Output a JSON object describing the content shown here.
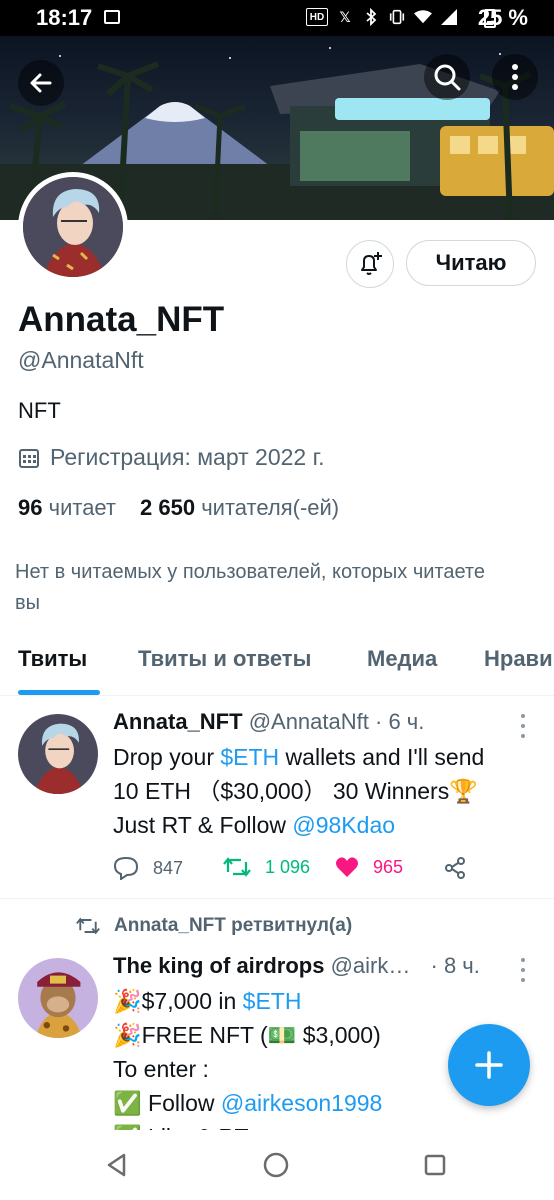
{
  "status_bar": {
    "time": "18:17",
    "battery": "25 %",
    "icons": [
      "picture-icon",
      "hd-signal-icon",
      "x-icon",
      "bluetooth-icon",
      "vibrate-icon",
      "wifi-icon",
      "signal-icon",
      "battery-icon"
    ]
  },
  "header": {
    "back_icon": "arrow-left-icon",
    "search_icon": "search-icon",
    "more_icon": "more-vertical-icon"
  },
  "profile": {
    "display_name": "Annata_NFT",
    "handle": "@AnnataNft",
    "bio": "NFT",
    "joined": "Регистрация: март 2022 г.",
    "following_count": "96",
    "following_label": "читает",
    "followers_count": "2 650",
    "followers_label": "читателя(-ей)",
    "mutuals_note": "Нет в читаемых у пользователей, которых читаете вы",
    "follow_button": "Читаю",
    "notify_icon": "bell-plus-icon"
  },
  "tabs": [
    {
      "label": "Твиты",
      "active": true
    },
    {
      "label": "Твиты и ответы",
      "active": false
    },
    {
      "label": "Медиа",
      "active": false
    },
    {
      "label": "Нрави",
      "active": false
    }
  ],
  "tweets": [
    {
      "name": "Annata_NFT",
      "handle": "@AnnataNft",
      "time": "· 6 ч.",
      "line1_pre": "Drop your ",
      "line1_link": "$ETH",
      "line1_post": " wallets and I'll send",
      "line2": "10 ETH （$30,000） 30 Winners🏆",
      "line3_pre": "Just RT & Follow ",
      "line3_link": "@98Kdao",
      "replies": "847",
      "retweets": "1 096",
      "likes": "965"
    },
    {
      "retweeted_by": "Annata_NFT ретвитнул(а)",
      "name": "The king of airdrops",
      "handle": "@airk…",
      "time": "· 8 ч.",
      "line1_pre": "🎉$7,000 in ",
      "line1_link": "$ETH",
      "line2": "🎉FREE NFT (💵 $3,000)",
      "line3": "To enter :",
      "line4_pre": "✅ Follow ",
      "line4_link": "@airkeson1998",
      "line5": "✅ Like & RT"
    }
  ],
  "colors": {
    "accent": "#1d9bf0",
    "retweet": "#00ba7c",
    "like": "#f91880",
    "muted": "#536471"
  },
  "fab_icon": "plus-icon",
  "nav": [
    "back-triangle-icon",
    "home-circle-icon",
    "recents-square-icon"
  ]
}
